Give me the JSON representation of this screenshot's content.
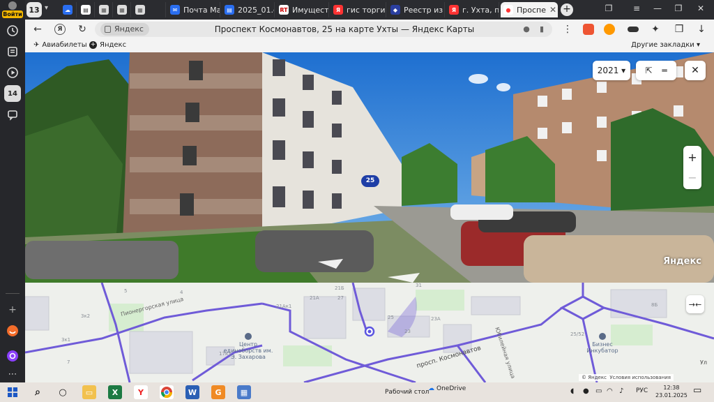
{
  "sidebar": {
    "login_label": "Войти",
    "mail_count": "14"
  },
  "tabs": {
    "count": "13",
    "items": [
      {
        "label": "",
        "icon": "cloud-icon"
      },
      {
        "label": "",
        "icon": "doc-icon"
      },
      {
        "label": "",
        "icon": "image-icon"
      },
      {
        "label": "",
        "icon": "image-icon"
      },
      {
        "label": "",
        "icon": "image-icon"
      },
      {
        "label": "Почта Ма",
        "icon": "mail-icon"
      },
      {
        "label": "2025_01.d",
        "icon": "doc-icon"
      },
      {
        "label": "Имущест",
        "icon": "rts-icon"
      },
      {
        "label": "гис торги",
        "icon": "yandex-icon"
      },
      {
        "label": "Реестр из",
        "icon": "gov-icon"
      },
      {
        "label": "г. Ухта, пр",
        "icon": "yandex-icon"
      },
      {
        "label": "Проспе",
        "icon": "maps-pin-icon",
        "active": true
      }
    ]
  },
  "navbar": {
    "site": "Яндекс",
    "page_title": "Проспект Космонавтов, 25 на карте Ухты — Яндекс Карты"
  },
  "bookmarks": {
    "items": [
      "Авиабилеты",
      "Яндекс"
    ],
    "other": "Другие закладки"
  },
  "panorama": {
    "year": "2021",
    "house_number": "25",
    "watermark": "Яндекс"
  },
  "map": {
    "labels": [
      "5",
      "4",
      "3к2",
      "3к1",
      "7",
      "27",
      "21Б",
      "21А",
      "21Ак1",
      "25",
      "23",
      "23А",
      "Пионергорская улица",
      "просп. Космонавтов",
      "Юбилейная улица",
      "8Б",
      "25/52",
      "17к1",
      "31",
      "Ул"
    ],
    "poi_center": "Центр единоборств им. Э. Захарова",
    "poi_business": "Бизнес Инкубатор",
    "copyright": "© Яндекс",
    "terms": "Условия использования"
  },
  "taskbar": {
    "desktop_label": "Рабочий стол",
    "onedrive": "OneDrive",
    "lang": "РУС",
    "time": "12:38",
    "date": "23.01.2025"
  }
}
